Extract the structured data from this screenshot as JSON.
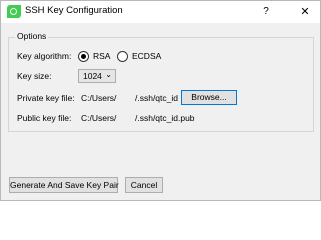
{
  "window": {
    "title": "SSH Key Configuration",
    "help_label": "?",
    "close_label": "✕"
  },
  "options": {
    "group_title": "Options",
    "algorithm_label": "Key algorithm:",
    "algorithm_options": [
      "RSA",
      "ECDSA"
    ],
    "algorithm_selected": "RSA",
    "key_size_label": "Key size:",
    "key_size_value": "1024",
    "private_key_label": "Private key file:",
    "private_key_path_left": "C:/Users/",
    "private_key_path_right": "/.ssh/qtc_id",
    "browse_label": "Browse...",
    "public_key_label": "Public key file:",
    "public_key_path_left": "C:/Users/",
    "public_key_path_right": "/.ssh/qtc_id.pub"
  },
  "actions": {
    "generate_label": "Generate And Save Key Pair",
    "cancel_label": "Cancel"
  },
  "colors": {
    "qt_green": "#41cd52",
    "focus_blue": "#0078d7"
  }
}
